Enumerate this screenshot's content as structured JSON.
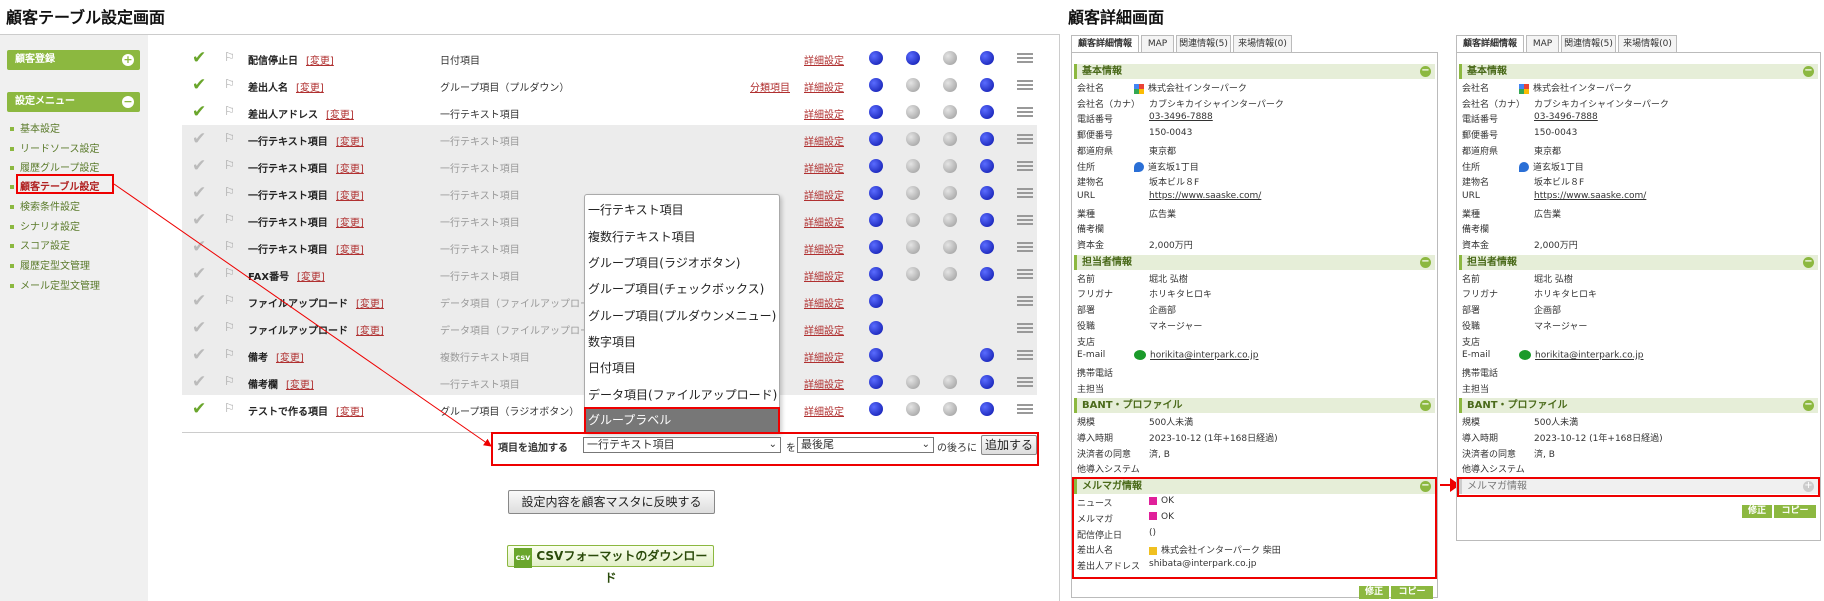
{
  "headings": {
    "left": "顧客テーブル設定画面",
    "right": "顧客詳細画面"
  },
  "sidebar": {
    "register_btn": "顧客登録",
    "menu_btn": "設定メニュー",
    "items": [
      "基本設定",
      "リードソース設定",
      "履歴グループ設定",
      "顧客テーブル設定",
      "検索条件設定",
      "シナリオ設定",
      "スコア設定",
      "履歴定型文管理",
      "メール定型文管理"
    ]
  },
  "table": {
    "change_label": "[変更]",
    "class_label": "分類項目",
    "detail_label": "詳細設定",
    "rows": [
      {
        "name": "配信停止日",
        "type": "日付項目",
        "cls": ""
      },
      {
        "name": "差出人名",
        "type": "グループ項目（プルダウン）",
        "cls": "分類項目"
      },
      {
        "name": "差出人アドレス",
        "type": "一行テキスト項目",
        "cls": ""
      },
      {
        "name": "一行テキスト項目",
        "type": "一行テキスト項目",
        "cls": ""
      },
      {
        "name": "一行テキスト項目",
        "type": "一行テキスト項目",
        "cls": ""
      },
      {
        "name": "一行テキスト項目",
        "type": "一行テキスト項目",
        "cls": ""
      },
      {
        "name": "一行テキスト項目",
        "type": "一行テキスト項目",
        "cls": ""
      },
      {
        "name": "一行テキスト項目",
        "type": "一行テキスト項目",
        "cls": ""
      },
      {
        "name": "FAX番号",
        "type": "一行テキスト項目",
        "cls": ""
      },
      {
        "name": "ファイルアップロード",
        "type": "データ項目（ファイルアップロード）",
        "cls": ""
      },
      {
        "name": "ファイルアップロード",
        "type": "データ項目（ファイルアップロード）",
        "cls": ""
      },
      {
        "name": "備考",
        "type": "複数行テキスト項目",
        "cls": ""
      },
      {
        "name": "備考欄",
        "type": "一行テキスト項目",
        "cls": ""
      },
      {
        "name": "テストで作る項目",
        "type": "グループ項目（ラジオボタン）",
        "cls": ""
      }
    ]
  },
  "dropdown": {
    "options": [
      "一行テキスト項目",
      "複数行テキスト項目",
      "グループ項目(ラジオボタン)",
      "グループ項目(チェックボックス)",
      "グループ項目(プルダウンメニュー)",
      "数字項目",
      "日付項目",
      "データ項目(ファイルアップロード)"
    ],
    "selected": "グループラベル"
  },
  "add_bar": {
    "label": "項目を追加する",
    "type_value": "一行テキスト項目",
    "wo": "を",
    "position_value": "最後尾",
    "after": "の後ろに",
    "add_btn": "追加する"
  },
  "reflect_btn": "設定内容を顧客マスタに反映する",
  "csv_btn": "CSVフォーマットのダウンロード",
  "detail": {
    "tabs": [
      "顧客詳細情報",
      "MAP",
      "関連情報(5)",
      "来場情報(0)"
    ],
    "basic_title": "基本情報",
    "basic": [
      [
        "会社名",
        "株式会社インターパーク"
      ],
      [
        "会社名（カナ）",
        "カブシキカイシャインターパーク"
      ],
      [
        "電話番号",
        "03-3496-7888"
      ],
      [
        "郵便番号",
        "150-0043"
      ],
      [
        "都道府県",
        "東京都"
      ],
      [
        "住所",
        "道玄坂1丁目"
      ],
      [
        "建物名",
        "坂本ビル８F"
      ],
      [
        "URL",
        "https://www.saaske.com/"
      ],
      [
        "業種",
        "広告業"
      ],
      [
        "備考欄",
        ""
      ],
      [
        "資本金",
        "2,000万円"
      ]
    ],
    "contact_title": "担当者情報",
    "contact": [
      [
        "名前",
        "堀北 弘樹"
      ],
      [
        "フリガナ",
        "ホリキタヒロキ"
      ],
      [
        "部署",
        "企画部"
      ],
      [
        "役職",
        "マネージャー"
      ],
      [
        "支店",
        ""
      ],
      [
        "E-mail",
        "horikita@interpark.co.jp"
      ],
      [
        "携帯電話",
        ""
      ],
      [
        "主担当",
        ""
      ]
    ],
    "bant_title": "BANT・プロファイル",
    "bant": [
      [
        "規模",
        "500人未満"
      ],
      [
        "導入時期",
        "2023-10-12 (1年+168日経過)"
      ],
      [
        "決済者の同意",
        "済, B"
      ],
      [
        "他導入システム",
        ""
      ]
    ],
    "mail_title": "メルマガ情報",
    "mail": [
      [
        "ニュース",
        "OK"
      ],
      [
        "メルマガ",
        "OK"
      ],
      [
        "配信停止日",
        "()"
      ],
      [
        "差出人名",
        "株式会社インターパーク 柴田"
      ],
      [
        "差出人アドレス",
        "shibata@interpark.co.jp"
      ]
    ],
    "edit_btn": "修正",
    "copy_btn": "コピー"
  },
  "colors": {
    "accent": "#8cb840",
    "highlight": "#e00000",
    "link": "#b03030"
  }
}
